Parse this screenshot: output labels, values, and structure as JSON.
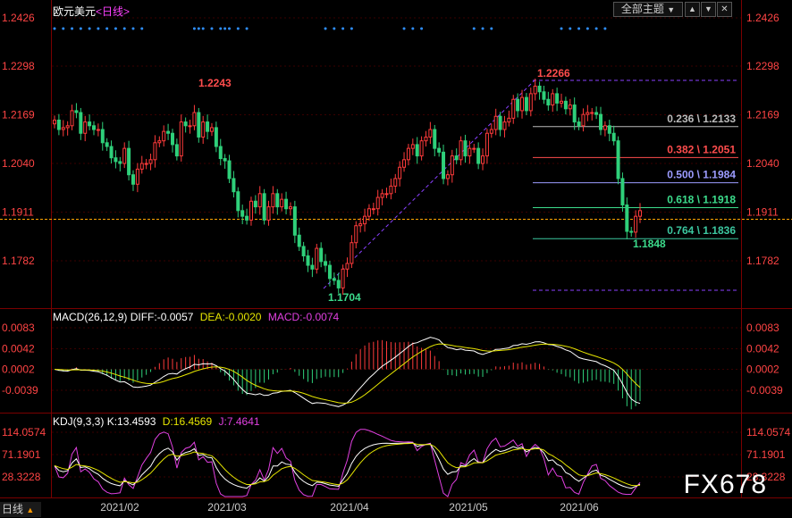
{
  "header": {
    "symbol": "欧元美元",
    "period_prefix": "<",
    "period": "日线",
    "period_suffix": ">",
    "theme_button": "全部主题",
    "theme_arrow": "▼",
    "btn_up": "▲",
    "btn_down": "▼",
    "btn_close": "✕"
  },
  "colors": {
    "up": "#ff3b3b",
    "down": "#2fd07a",
    "axis_label": "#ff4444",
    "grid": "#3a0000",
    "white_line": "#ffffff",
    "yellow_line": "#e6e600",
    "magenta_line": "#e040e0",
    "fib_gray": "#bbbbbb",
    "fib_red": "#ff4d4d",
    "fib_blue": "#9c9cff",
    "fib_green": "#3cdc8c",
    "fib_teal": "#3cc8a0",
    "dots": "#2f8fff"
  },
  "price_axis": {
    "ticks": [
      "1.2426",
      "1.2298",
      "1.2169",
      "1.2040",
      "1.1911",
      "1.1782"
    ],
    "current": "1.1911",
    "current_line_color": "#ffa500"
  },
  "annotations": {
    "high1": "1.2243",
    "high2": "1.2266",
    "low1": "1.1704",
    "low2": "1.1848"
  },
  "fib_levels": [
    {
      "label": "0.236 \\ 1.2133",
      "price": 1.2133,
      "color": "#bbbbbb"
    },
    {
      "label": "0.382 \\ 1.2051",
      "price": 1.2051,
      "color": "#ff4d4d"
    },
    {
      "label": "0.500 \\ 1.1984",
      "price": 1.1984,
      "color": "#9c9cff"
    },
    {
      "label": "0.618 \\ 1.1918",
      "price": 1.1918,
      "color": "#3cdc8c"
    },
    {
      "label": "0.764 \\ 1.1836",
      "price": 1.1836,
      "color": "#3cc8a0"
    }
  ],
  "macd": {
    "title": "MACD(26,12,9)",
    "diff_label": "DIFF:-0.0057",
    "dea_label": "DEA:-0.0020",
    "macd_label": "MACD:-0.0074",
    "ticks": [
      "0.0083",
      "0.0042",
      "0.0002",
      "-0.0039"
    ]
  },
  "kdj": {
    "title": "KDJ(9,3,3)",
    "k_label": "K:13.4593",
    "d_label": "D:16.4569",
    "j_label": "J:7.4641",
    "ticks": [
      "114.0574",
      "71.1901",
      "28.3228"
    ]
  },
  "time_axis": {
    "period_button": "日线",
    "period_arrow": "▲",
    "labels": [
      "2021/02",
      "2021/03",
      "2021/04",
      "2021/05",
      "2021/06"
    ]
  },
  "watermark": "FX678",
  "chart_data": {
    "type": "candlestick",
    "title": "欧元美元 日线",
    "ylim": [
      1.17,
      1.2426
    ],
    "x": [
      "2021/02",
      "2021/03",
      "2021/04",
      "2021/05",
      "2021/06"
    ],
    "close": [
      1.2155,
      1.213,
      1.2135,
      1.214,
      1.218,
      1.2175,
      1.212,
      1.215,
      1.214,
      1.213,
      1.213,
      1.2095,
      1.2085,
      1.2055,
      1.2045,
      1.204,
      1.208,
      1.201,
      1.1985,
      1.2025,
      1.204,
      1.204,
      1.205,
      1.2095,
      1.21,
      1.2125,
      1.212,
      1.209,
      1.206,
      1.215,
      1.214,
      1.214,
      1.2175,
      1.211,
      1.215,
      1.2125,
      1.2135,
      1.2085,
      1.2053,
      1.2047,
      1.2,
      1.1965,
      1.1915,
      1.19,
      1.189,
      1.194,
      1.1925,
      1.196,
      1.189,
      1.1925,
      1.196,
      1.1925,
      1.1945,
      1.192,
      1.1925,
      1.185,
      1.182,
      1.1795,
      1.177,
      1.176,
      1.1815,
      1.178,
      1.177,
      1.1735,
      1.173,
      1.171,
      1.176,
      1.1775,
      1.183,
      1.1875,
      1.188,
      1.19,
      1.192,
      1.192,
      1.195,
      1.196,
      1.196,
      1.198,
      1.2,
      1.203,
      1.205,
      1.208,
      1.209,
      1.206,
      1.21,
      1.211,
      1.213,
      1.208,
      1.207,
      1.2,
      1.201,
      1.206,
      1.205,
      1.21,
      1.206,
      1.208,
      1.208,
      1.204,
      1.206,
      1.212,
      1.213,
      1.2165,
      1.213,
      1.215,
      1.216,
      1.221,
      1.218,
      1.2215,
      1.218,
      1.2225,
      1.2245,
      1.223,
      1.221,
      1.2195,
      1.2225,
      1.22,
      1.2205,
      1.2185,
      1.2195,
      1.215,
      1.214,
      1.217,
      1.2175,
      1.2175,
      1.217,
      1.213,
      1.214,
      1.212,
      1.21,
      1.2,
      1.193,
      1.186,
      1.1858,
      1.19,
      1.1915
    ]
  }
}
